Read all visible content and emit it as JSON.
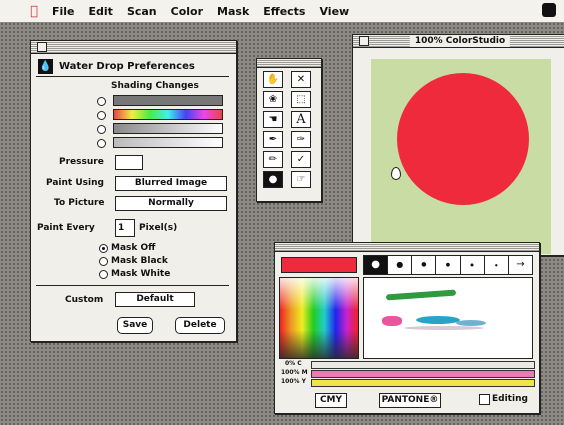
{
  "menubar": {
    "items": [
      "File",
      "Edit",
      "Scan",
      "Color",
      "Mask",
      "Effects",
      "View"
    ]
  },
  "prefs": {
    "title": "Water Drop Preferences",
    "shading_label": "Shading Changes",
    "pressure_label": "Pressure",
    "paint_using_label": "Paint Using",
    "paint_using_value": "Blurred Image",
    "to_picture_label": "To Picture",
    "to_picture_value": "Normally",
    "paint_every_label": "Paint Every",
    "paint_every_value": "1",
    "pixels_label": "Pixel(s)",
    "mask_options": [
      "Mask Off",
      "Mask Black",
      "Mask White"
    ],
    "mask_selected": "Mask Off",
    "custom_label": "Custom",
    "custom_value": "Default",
    "save_label": "Save",
    "delete_label": "Delete"
  },
  "tools": [
    "hand-icon",
    "magnify-icon",
    "lasso-icon",
    "marquee-icon",
    "bucket-icon",
    "text-icon",
    "pen-icon",
    "brush-icon",
    "pencil-icon",
    "eyedropper-icon",
    "water-drop-icon",
    "smudge-icon"
  ],
  "tool_text": "A",
  "canvas": {
    "title": "100% ColorStudio",
    "circle_color": "#ee2a3c",
    "background": "#c9dca4"
  },
  "palette": {
    "current_color": "#ee2a3c",
    "sliders": [
      {
        "label": "0% C",
        "color": "#e9e8e3"
      },
      {
        "label": "100% M",
        "color": "#ee7ab5"
      },
      {
        "label": "100% Y",
        "color": "#f0e449"
      }
    ],
    "cmy_label": "CMY",
    "pantone_label": "PANTONE®",
    "editing_label": "Editing",
    "editing_checked": false
  }
}
